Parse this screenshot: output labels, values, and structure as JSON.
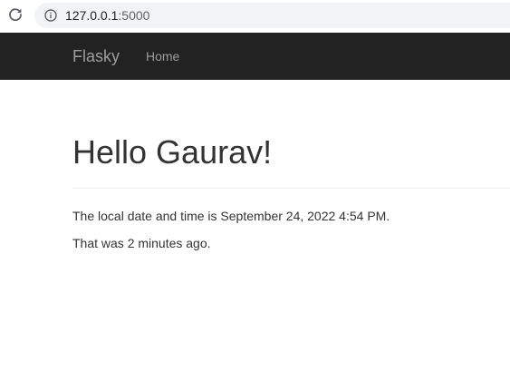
{
  "browser": {
    "url_host": "127.0.0.1",
    "url_port": ":5000",
    "icons": [
      "reload-icon",
      "info-icon"
    ]
  },
  "navbar": {
    "brand": "Flasky",
    "links": [
      {
        "label": "Home"
      }
    ]
  },
  "main": {
    "heading": "Hello Gaurav!",
    "local_time_text": "The local date and time is September 24, 2022 4:54 PM.",
    "relative_time_text": "That was 2 minutes ago."
  },
  "colors": {
    "navbar_bg": "#222222",
    "navbar_text": "#9d9d9d",
    "address_bar_bg": "#f1f3f4",
    "text": "#333333"
  }
}
